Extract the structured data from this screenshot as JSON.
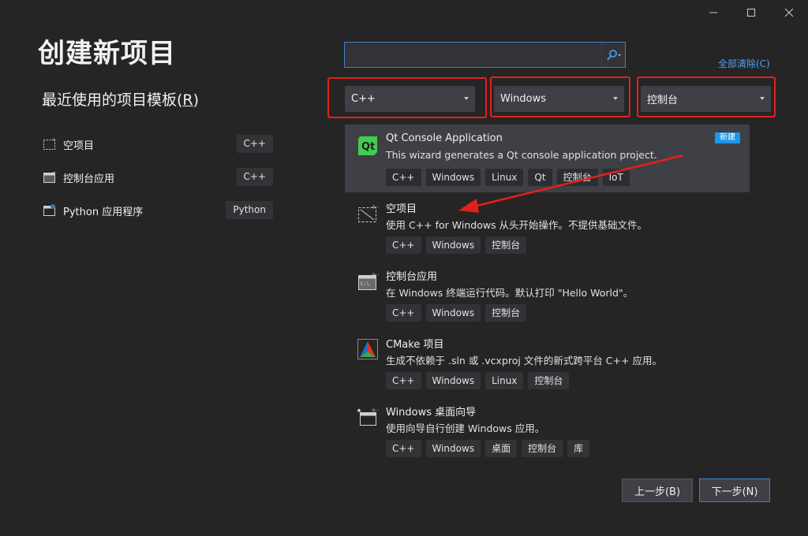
{
  "window": {
    "minimize": "—",
    "maximize": "☐",
    "close": "✕"
  },
  "page_title": "创建新项目",
  "recent": {
    "title": "最近使用的项目模板(",
    "hotkey": "R",
    "title_end": ")",
    "items": [
      {
        "label": "空项目",
        "tag": "C++",
        "icon": "empty-project-icon"
      },
      {
        "label": "控制台应用",
        "tag": "C++",
        "icon": "console-app-icon"
      },
      {
        "label": "Python 应用程序",
        "tag": "Python",
        "icon": "python-app-icon"
      }
    ]
  },
  "search": {
    "value": "",
    "placeholder": ""
  },
  "clear_all": "全部清除(C)",
  "filters": {
    "language": "C++",
    "platform": "Windows",
    "project_type": "控制台"
  },
  "templates": [
    {
      "name": "Qt Console Application",
      "desc": "This wizard generates a Qt console application project.",
      "tags": [
        "C++",
        "Windows",
        "Linux",
        "Qt",
        "控制台",
        "IoT"
      ],
      "badge": "新建",
      "icon": "qt-icon"
    },
    {
      "name": "空项目",
      "desc": "使用 C++ for Windows 从头开始操作。不提供基础文件。",
      "tags": [
        "C++",
        "Windows",
        "控制台"
      ],
      "icon": "empty-project-icon"
    },
    {
      "name": "控制台应用",
      "desc": "在 Windows 终端运行代码。默认打印 \"Hello World\"。",
      "tags": [
        "C++",
        "Windows",
        "控制台"
      ],
      "icon": "console-app-icon"
    },
    {
      "name": "CMake 项目",
      "desc": "生成不依赖于 .sln 或 .vcxproj 文件的新式跨平台 C++ 应用。",
      "tags": [
        "C++",
        "Windows",
        "Linux",
        "控制台"
      ],
      "icon": "cmake-icon"
    },
    {
      "name": "Windows 桌面向导",
      "desc": "使用向导自行创建 Windows 应用。",
      "tags": [
        "C++",
        "Windows",
        "桌面",
        "控制台",
        "库"
      ],
      "icon": "desktop-wizard-icon"
    }
  ],
  "buttons": {
    "back": "上一步(B)",
    "next": "下一步(N)"
  },
  "colors": {
    "highlight": "#e2211d",
    "accent": "#3f7fc9",
    "link": "#4ea0f5",
    "badge": "#1c97ea",
    "background": "#252526"
  }
}
